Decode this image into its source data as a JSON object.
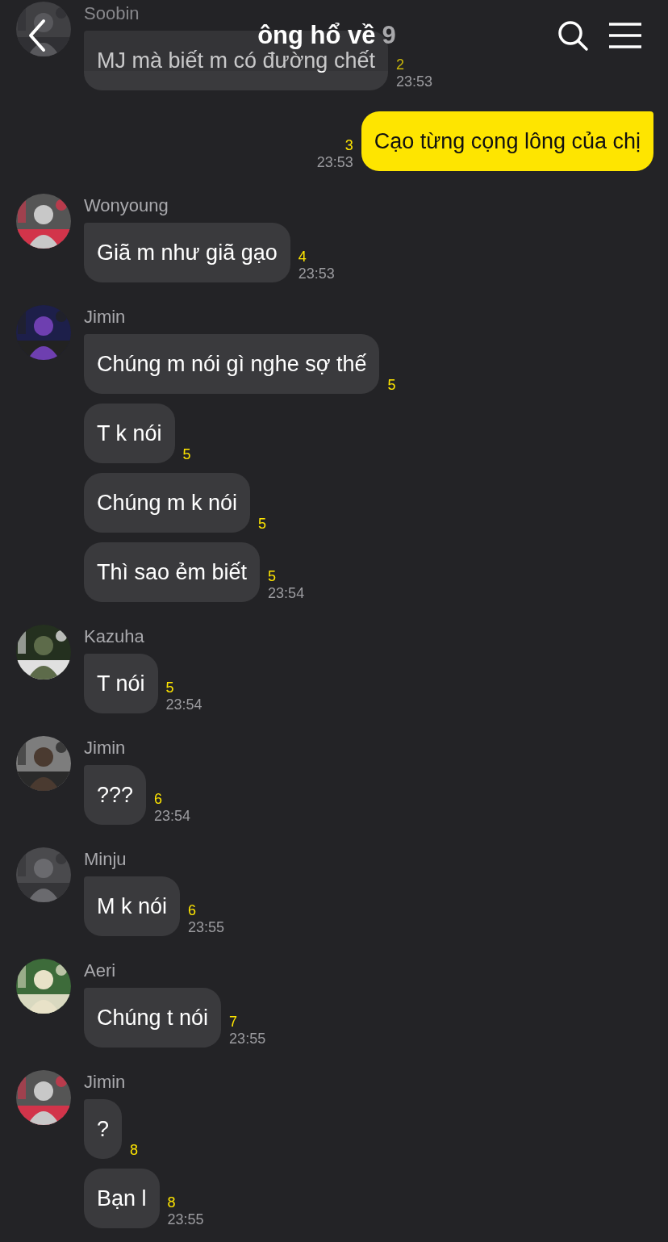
{
  "header": {
    "title": "ông hổ về",
    "member_count": "9"
  },
  "groups": [
    {
      "kind": "incoming",
      "sender": "Soobin",
      "avatar": {
        "kind": "picture"
      },
      "bubbles": [
        {
          "text": "MJ mà biết m có đường chết",
          "unread": "2",
          "time": "23:53"
        }
      ]
    },
    {
      "kind": "outgoing",
      "bubbles": [
        {
          "text": "Cạo từng cọng lông của chị",
          "unread": "3",
          "time": "23:53"
        }
      ]
    },
    {
      "kind": "incoming",
      "sender": "Wonyoung",
      "avatar": {
        "kind": "picture"
      },
      "bubbles": [
        {
          "text": "Giã m như giã gạo",
          "unread": "4",
          "time": "23:53"
        }
      ]
    },
    {
      "kind": "incoming",
      "sender": "Jimin",
      "avatar": {
        "kind": "picture"
      },
      "bubbles": [
        {
          "text": "Chúng m nói gì nghe sợ thế",
          "unread": "5"
        },
        {
          "text": "T k nói",
          "unread": "5"
        },
        {
          "text": "Chúng m k nói",
          "unread": "5"
        },
        {
          "text": "Thì sao ẻm biết",
          "unread": "5",
          "time": "23:54"
        }
      ]
    },
    {
      "kind": "incoming",
      "sender": "Kazuha",
      "avatar": {
        "kind": "picture"
      },
      "bubbles": [
        {
          "text": "T nói",
          "unread": "5",
          "time": "23:54"
        }
      ]
    },
    {
      "kind": "incoming",
      "sender": "Jimin",
      "avatar": {
        "kind": "picture"
      },
      "bubbles": [
        {
          "text": "???",
          "unread": "6",
          "time": "23:54"
        }
      ]
    },
    {
      "kind": "incoming",
      "sender": "Minju",
      "avatar": {
        "kind": "picture"
      },
      "bubbles": [
        {
          "text": "M k nói",
          "unread": "6",
          "time": "23:55"
        }
      ]
    },
    {
      "kind": "incoming",
      "sender": "Aeri",
      "avatar": {
        "kind": "picture"
      },
      "bubbles": [
        {
          "text": "Chúng t nói",
          "unread": "7",
          "time": "23:55"
        }
      ]
    },
    {
      "kind": "incoming",
      "sender": "Jimin",
      "avatar": {
        "kind": "picture"
      },
      "bubbles": [
        {
          "text": "?",
          "unread": "8"
        },
        {
          "text": "Bạn l",
          "unread": "8",
          "time": "23:55"
        }
      ]
    }
  ]
}
